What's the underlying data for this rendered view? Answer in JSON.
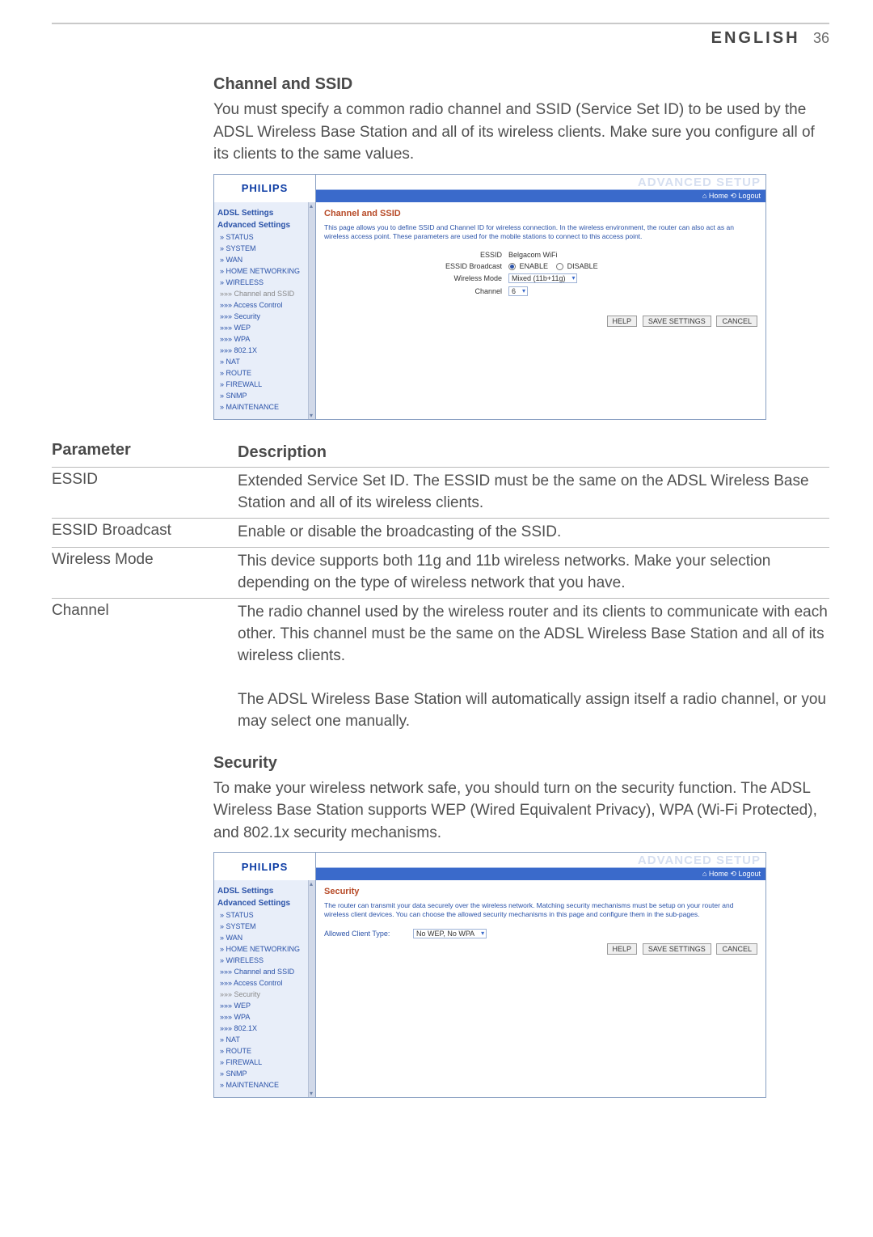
{
  "header": {
    "lang": "ENGLISH",
    "page_num": "36"
  },
  "section1": {
    "title": "Channel and SSID",
    "para": "You must specify a common radio channel and SSID (Service Set ID) to be used by the ADSL Wireless Base Station and all of its wireless clients. Make sure you configure all of its clients to the same values."
  },
  "screenshot_common": {
    "logo": "PHILIPS",
    "adv": "ADVANCED SETUP",
    "home_logout": "⌂ Home   ⟲ Logout",
    "nav_hd1": "ADSL Settings",
    "nav_hd2": "Advanced Settings",
    "items": {
      "status": "» STATUS",
      "system": "» SYSTEM",
      "wan": "» WAN",
      "home_net": "» HOME NETWORKING",
      "wireless": "» WIRELESS",
      "chan_ssid": "»»» Channel and SSID",
      "access_ctl": "»»» Access Control",
      "security": "»»» Security",
      "wep": "»»» WEP",
      "wpa": "»»» WPA",
      "x8021": "»»» 802.1X",
      "nat": "» NAT",
      "route": "» ROUTE",
      "firewall": "» FIREWALL",
      "snmp": "» SNMP",
      "maint": "» MAINTENANCE"
    },
    "btn_help": "HELP",
    "btn_save": "SAVE SETTINGS",
    "btn_cancel": "CANCEL"
  },
  "sshot1": {
    "title": "Channel and SSID",
    "desc": "This page allows you to define SSID and Channel ID for wireless connection. In the wireless environment, the router can also act as an wireless access point. These parameters are used for the mobile stations to connect to this access point.",
    "row_essid_lbl": "ESSID",
    "row_essid_val": "Belgacom WiFi",
    "row_bcast_lbl": "ESSID Broadcast",
    "row_bcast_en": "ENABLE",
    "row_bcast_dis": "DISABLE",
    "row_mode_lbl": "Wireless Mode",
    "row_mode_val": "Mixed (11b+11g)",
    "row_chan_lbl": "Channel",
    "row_chan_val": "6"
  },
  "ptable": {
    "head_l": "Parameter",
    "head_r": "Description",
    "rows": [
      {
        "l": "ESSID",
        "r": "Extended Service Set ID. The ESSID must be the same on the ADSL Wireless Base Station and all of its wireless clients."
      },
      {
        "l": "ESSID Broadcast",
        "r": "Enable or disable the broadcasting of the SSID."
      },
      {
        "l": "Wireless Mode",
        "r": "This device supports both 11g and 11b wireless networks. Make your selection depending on the type of wireless network that you have."
      },
      {
        "l": "Channel",
        "r": "The radio channel used by the wireless router and its clients to communicate with each other. This channel must be the same on the ADSL Wireless Base Station and all of its wireless clients.\n\nThe ADSL Wireless Base Station will automatically assign itself a radio channel, or you may select one manually."
      }
    ]
  },
  "section2": {
    "title": "Security",
    "para": "To make your wireless network safe, you should turn on the security function. The ADSL Wireless Base Station supports WEP (Wired Equivalent Privacy), WPA (Wi-Fi Protected), and 802.1x security mechanisms."
  },
  "sshot2": {
    "title": "Security",
    "desc": "The router can transmit your data securely over the wireless network. Matching security mechanisms must be setup on your router and wireless client devices. You can choose the allowed security mechanisms in this page and configure them in the sub-pages.",
    "row_allowed_lbl": "Allowed Client Type:",
    "row_allowed_val": "No WEP, No WPA"
  }
}
